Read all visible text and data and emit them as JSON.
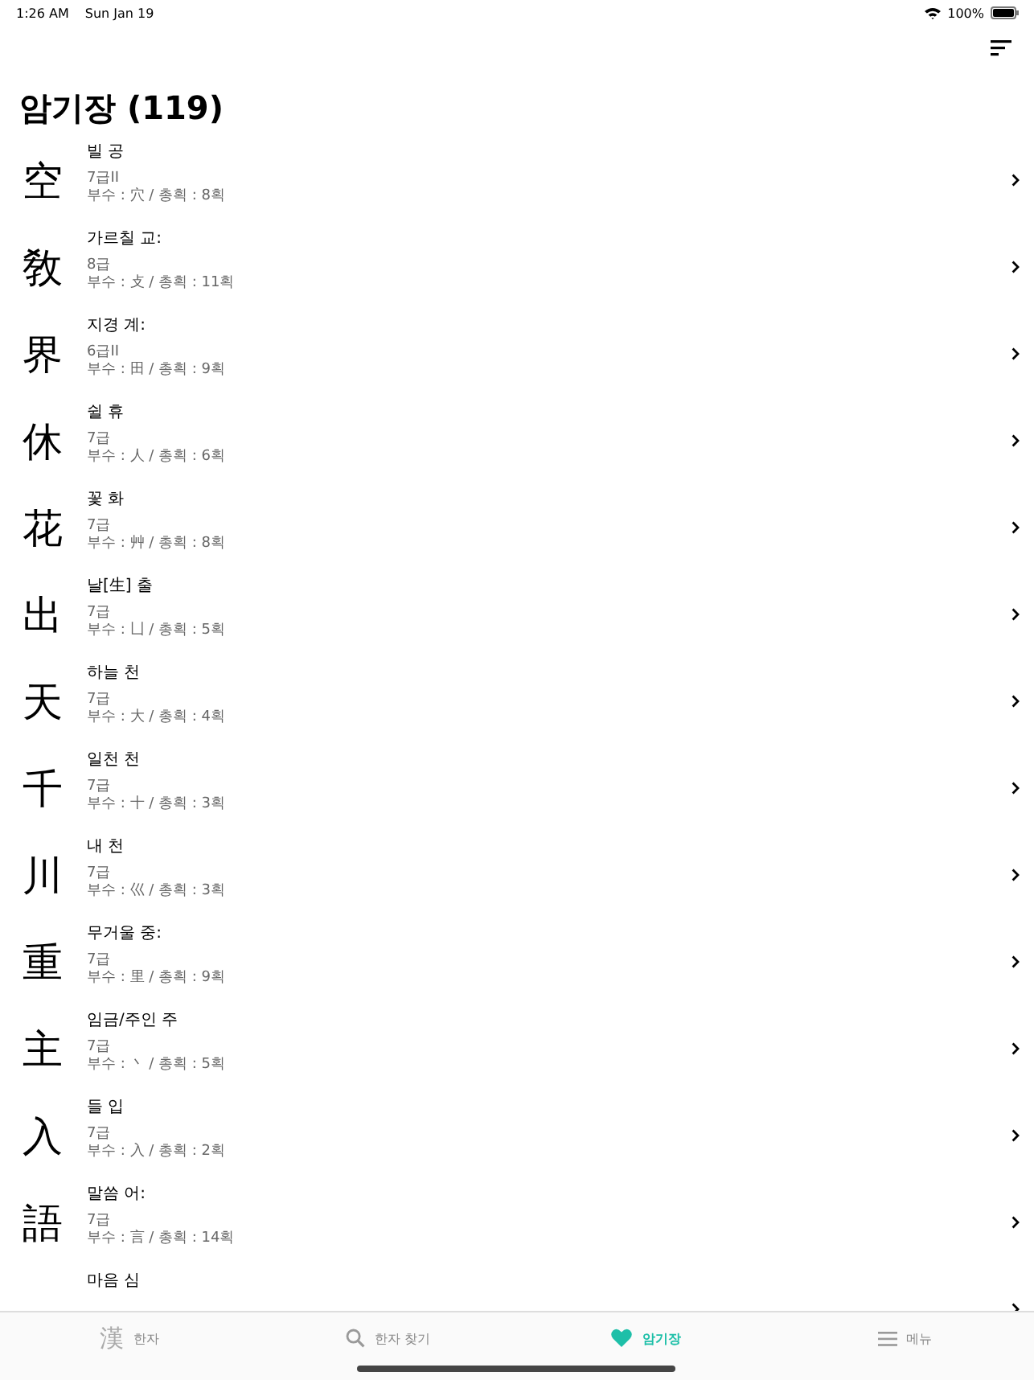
{
  "status_bar": {
    "time": "1:26 AM",
    "date": "Sun Jan 19",
    "battery": "100%"
  },
  "title": "암기장 (119)",
  "items": [
    {
      "hanja": "空",
      "meaning": "빌 공",
      "grade": "7급II",
      "info": "부수 : 穴 / 총획 : 8획"
    },
    {
      "hanja": "敎",
      "meaning": "가르칠 교:",
      "grade": "8급",
      "info": "부수 : 攴 / 총획 : 11획"
    },
    {
      "hanja": "界",
      "meaning": "지경 계:",
      "grade": "6급II",
      "info": "부수 : 田 / 총획 : 9획"
    },
    {
      "hanja": "休",
      "meaning": "쉴 휴",
      "grade": "7급",
      "info": "부수 : 人 / 총획 : 6획"
    },
    {
      "hanja": "花",
      "meaning": "꽃 화",
      "grade": "7급",
      "info": "부수 : 艸 / 총획 : 8획"
    },
    {
      "hanja": "出",
      "meaning": "날[生] 출",
      "grade": "7급",
      "info": "부수 : 凵 / 총획 : 5획"
    },
    {
      "hanja": "天",
      "meaning": "하늘 천",
      "grade": "7급",
      "info": "부수 : 大 / 총획 : 4획"
    },
    {
      "hanja": "千",
      "meaning": "일천 천",
      "grade": "7급",
      "info": "부수 : 十 / 총획 : 3획"
    },
    {
      "hanja": "川",
      "meaning": "내 천",
      "grade": "7급",
      "info": "부수 : 巛 / 총획 : 3획"
    },
    {
      "hanja": "重",
      "meaning": "무거울 중:",
      "grade": "7급",
      "info": "부수 : 里 / 총획 : 9획"
    },
    {
      "hanja": "主",
      "meaning": "임금/주인 주",
      "grade": "7급",
      "info": "부수 : 丶 / 총획 : 5획"
    },
    {
      "hanja": "入",
      "meaning": "들 입",
      "grade": "7급",
      "info": "부수 : 入 / 총획 : 2획"
    },
    {
      "hanja": "語",
      "meaning": "말씀 어:",
      "grade": "7급",
      "info": "부수 : 言 / 총획 : 14획"
    },
    {
      "meaning": "마음 심"
    }
  ],
  "tabs": [
    {
      "kind": "glyph",
      "glyph": "漢",
      "label": "한자",
      "selected": false
    },
    {
      "kind": "search",
      "label": "한자 찾기",
      "selected": false
    },
    {
      "kind": "heart",
      "label": "암기장",
      "selected": true
    },
    {
      "kind": "menu",
      "label": "메뉴",
      "selected": false
    }
  ]
}
